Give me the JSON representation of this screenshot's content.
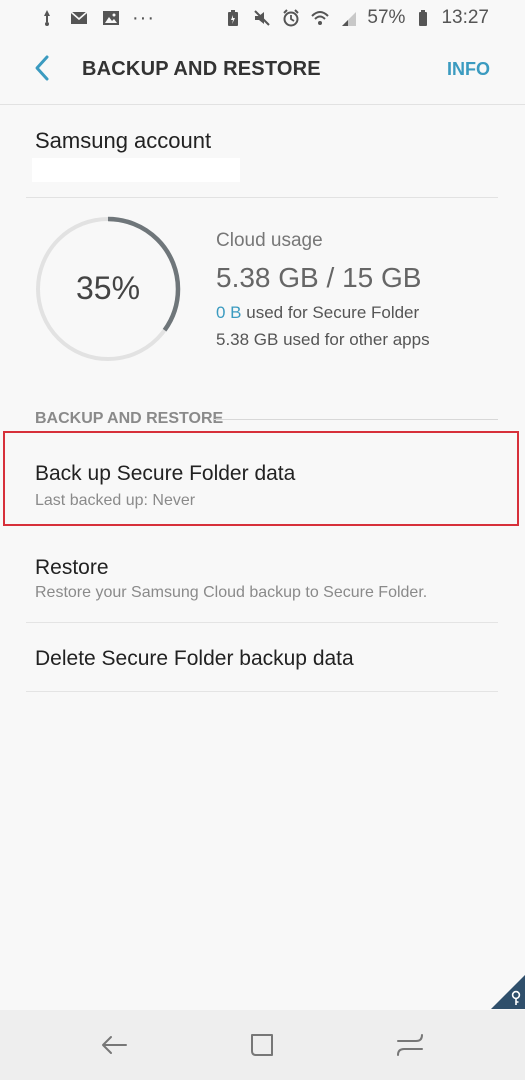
{
  "status_bar": {
    "battery_percent": "57%",
    "time": "13:27",
    "more_glyph": "···",
    "left_icons": [
      "notification-icon",
      "mail-icon",
      "image-icon"
    ],
    "right_icons": [
      "battery-saver-icon",
      "mute-icon",
      "alarm-icon",
      "wifi-icon",
      "signal-icon",
      "battery-icon"
    ]
  },
  "app_bar": {
    "title": "BACKUP AND RESTORE",
    "info_label": "INFO",
    "back_icon": "chevron-left-icon"
  },
  "account": {
    "title": "Samsung account",
    "email": ""
  },
  "cloud_usage": {
    "percent_label": "35%",
    "percent_value": 0.35,
    "label": "Cloud usage",
    "amount": "5.38 GB / 15 GB",
    "secure_folder_value": "0 B",
    "secure_folder_text": " used for Secure Folder",
    "other_apps_text": "5.38 GB used for other apps",
    "ring_track_color": "#e2e2e2",
    "ring_fill_color": "#6f767a"
  },
  "section": {
    "header": "BACKUP AND RESTORE"
  },
  "items": [
    {
      "title": "Back up Secure Folder data",
      "subtitle": "Last backed up: Never"
    },
    {
      "title": "Restore",
      "subtitle": "Restore your Samsung Cloud backup to Secure Folder."
    },
    {
      "title": "Delete Secure Folder backup data",
      "subtitle": ""
    }
  ],
  "nav_bar": {
    "icons": [
      "back-icon",
      "home-icon",
      "recents-icon"
    ]
  },
  "colors": {
    "accent": "#3b9bc0",
    "highlight": "#d7303a",
    "background": "#f8f8f8"
  }
}
